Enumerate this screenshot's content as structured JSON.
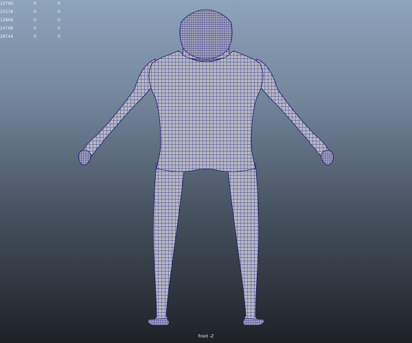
{
  "viewport": {
    "camera_label": "front -Z",
    "background_top": "#8ea4bd",
    "background_bottom": "#1e2227"
  },
  "hud": {
    "rows": [
      [
        "12790",
        "0",
        "0"
      ],
      [
        "25578",
        "0",
        "0"
      ],
      [
        "12806",
        "0",
        "0"
      ],
      [
        "24798",
        "0",
        "0"
      ],
      [
        "28744",
        "0",
        "0"
      ]
    ]
  },
  "model": {
    "wire_color": "#1e1e8a",
    "skin_color": "#b7b7c2",
    "icon": "wireframe-human-body"
  }
}
